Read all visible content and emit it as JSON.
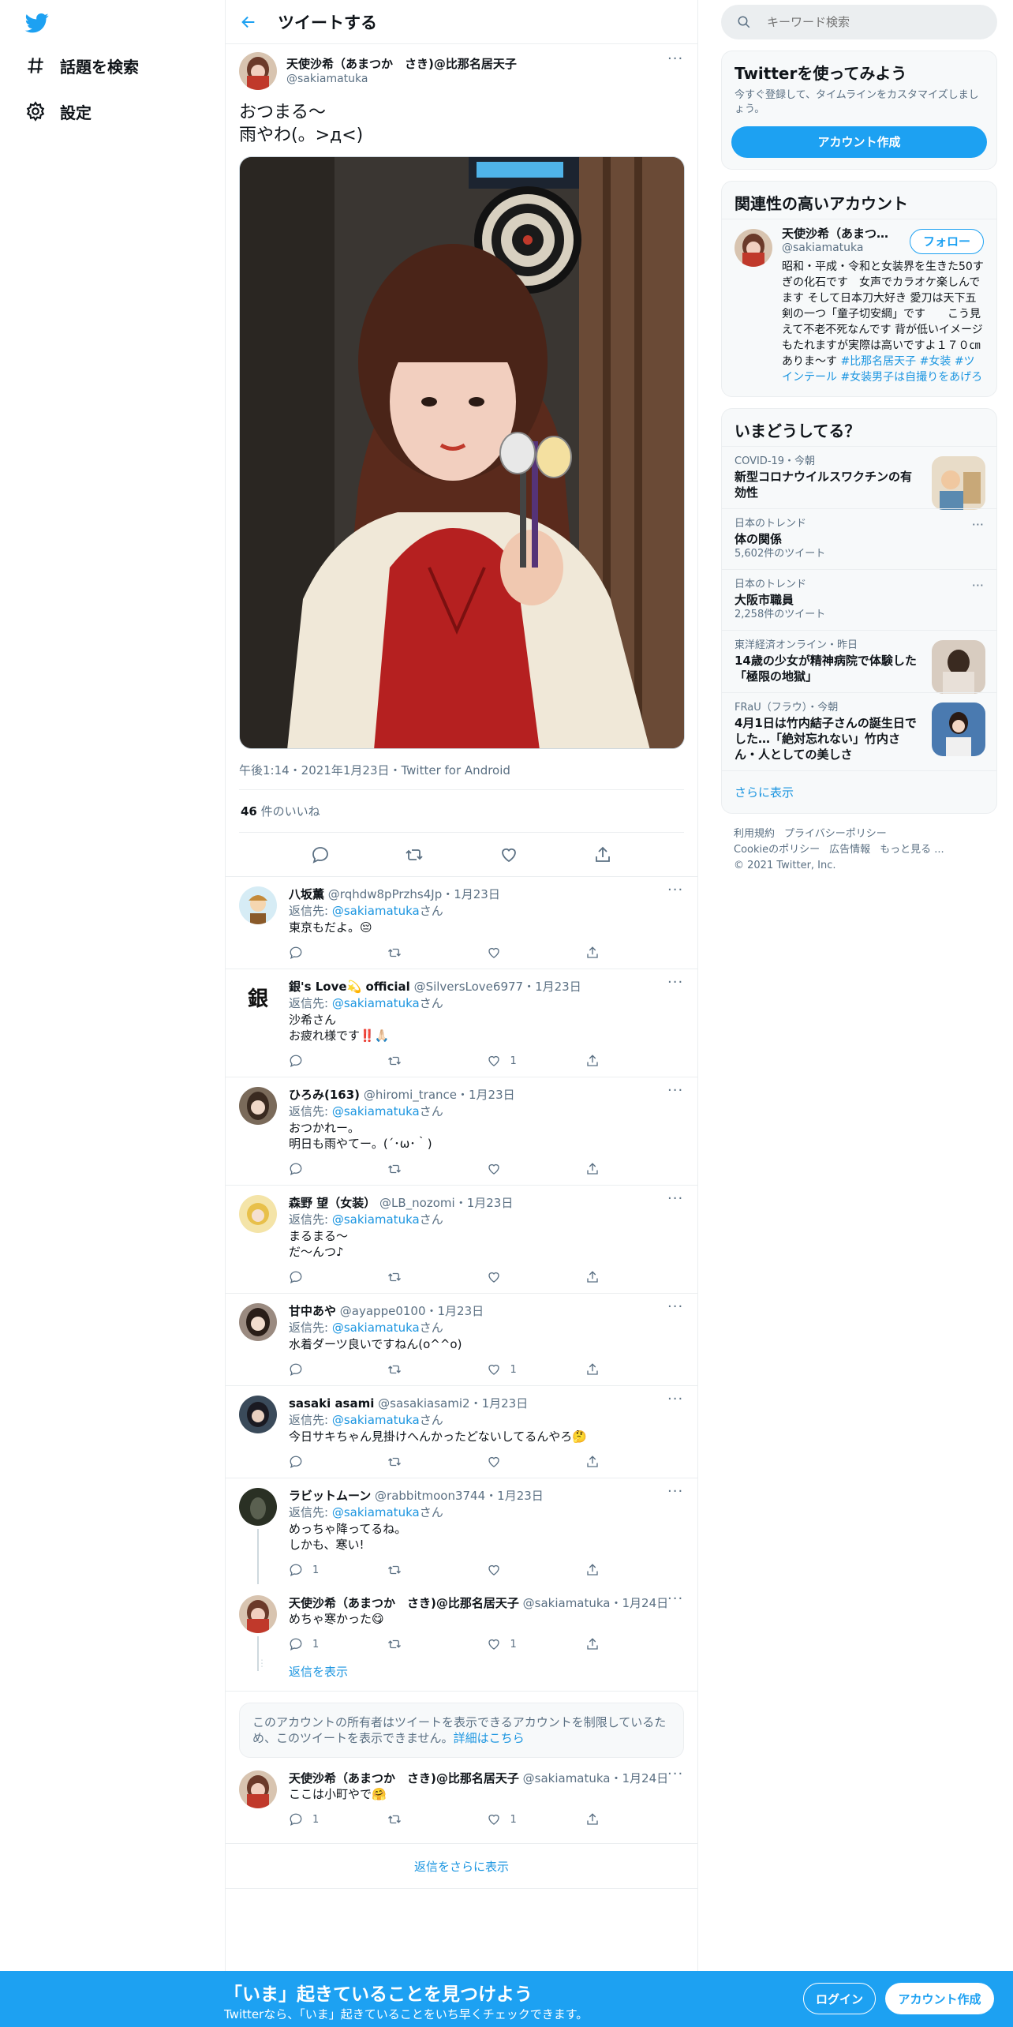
{
  "colors": {
    "brand": "#1da1f2",
    "link": "#1b95e0",
    "text": "#0f1419",
    "muted": "#5b7083"
  },
  "nav": {
    "logo_icon": "twitter-bird-icon",
    "items": [
      {
        "label": "話題を検索",
        "icon": "hashtag-icon"
      },
      {
        "label": "設定",
        "icon": "gear-icon"
      }
    ]
  },
  "header": {
    "title": "ツイートする"
  },
  "main_tweet": {
    "name": "天使沙希（あまつか　さき)@比那名居天子",
    "handle": "@sakiamatuka",
    "text": "おつまる〜\n雨やわ(。>д<)",
    "timestamp": "午後1:14・2021年1月23日・Twitter for Android",
    "likes_count": "46",
    "likes_label": " 件のいいね"
  },
  "replies": [
    {
      "name": "八坂薫",
      "handle": "@rqhdw8pPrzhs4Jp",
      "date": "・1月23日",
      "reply_to_label": "返信先: ",
      "reply_to": "@sakiamatuka",
      "reply_to_suffix": "さん",
      "text": "東京もだよ。😔",
      "reply_count": "",
      "retweet_count": "",
      "like_count": ""
    },
    {
      "name": "銀's Love💫 official",
      "handle": "@SilversLove6977",
      "date": "・1月23日",
      "reply_to_label": "返信先: ",
      "reply_to": "@sakiamatuka",
      "reply_to_suffix": "さん",
      "text": "沙希さん\nお疲れ様です‼️🙏🏻",
      "reply_count": "",
      "retweet_count": "",
      "like_count": "1"
    },
    {
      "name": "ひろみ(163)",
      "handle": "@hiromi_trance",
      "date": "・1月23日",
      "reply_to_label": "返信先: ",
      "reply_to": "@sakiamatuka",
      "reply_to_suffix": "さん",
      "text": "おつかれー。\n明日も雨やてー。(´･ω･｀)",
      "reply_count": "",
      "retweet_count": "",
      "like_count": ""
    },
    {
      "name": "森野 望（女装）",
      "handle": "@LB_nozomi",
      "date": "・1月23日",
      "reply_to_label": "返信先: ",
      "reply_to": "@sakiamatuka",
      "reply_to_suffix": "さん",
      "text": "まるまる〜\nだ〜んつ♪",
      "reply_count": "",
      "retweet_count": "",
      "like_count": ""
    },
    {
      "name": "甘中あや",
      "handle": "@ayappe0100",
      "date": "・1月23日",
      "reply_to_label": "返信先: ",
      "reply_to": "@sakiamatuka",
      "reply_to_suffix": "さん",
      "text": "水着ダーツ良いですねん(o^^o)",
      "reply_count": "",
      "retweet_count": "",
      "like_count": "1"
    },
    {
      "name": "sasaki asami",
      "handle": "@sasakiasami2",
      "date": "・1月23日",
      "reply_to_label": "返信先: ",
      "reply_to": "@sakiamatuka",
      "reply_to_suffix": "さん",
      "text": "今日サキちゃん見掛けへんかったどないしてるんやろ🤔",
      "reply_count": "",
      "retweet_count": "",
      "like_count": ""
    },
    {
      "name": "ラビットムーン",
      "handle": "@rabbitmoon3744",
      "date": "・1月23日",
      "reply_to_label": "返信先: ",
      "reply_to": "@sakiamatuka",
      "reply_to_suffix": "さん",
      "text": "めっちゃ降ってるね。\nしかも、寒い!",
      "reply_count": "1",
      "retweet_count": "",
      "like_count": ""
    },
    {
      "name": "天使沙希（あまつか　さき)@比那名居天子",
      "handle": "@sakiamatuka",
      "date": "・1月24日",
      "text": "めちゃ寒かった😋",
      "reply_count": "1",
      "retweet_count": "",
      "like_count": "1"
    }
  ],
  "show_replies_label": "返信を表示",
  "restricted_notice": {
    "text": "このアカウントの所有者はツイートを表示できるアカウントを制限しているため、このツイートを表示できません。",
    "link": "詳細はこちら"
  },
  "last_reply": {
    "name": "天使沙希（あまつか　さき)@比那名居天子",
    "handle": "@sakiamatuka",
    "date": "・1月24日",
    "text": "ここは小町やで🤗",
    "reply_count": "1",
    "retweet_count": "",
    "like_count": "1"
  },
  "more_replies_label": "返信をさらに表示",
  "search": {
    "placeholder": "キーワード検索"
  },
  "join_card": {
    "title": "Twitterを使ってみよう",
    "subtitle": "今すぐ登録して、タイムラインをカスタマイズしましょう。",
    "button": "アカウント作成"
  },
  "related": {
    "title": "関連性の高いアカウント",
    "name": "天使沙希（あまつか　さき)@比那名居天子",
    "handle": "@sakiamatuka",
    "follow_label": "フォロー",
    "bio": "昭和・平成・令和と女装界を生きた50すぎの化石です　女声でカラオケ楽しんでます そして日本刀大好き 愛刀は天下五剣の一つ「童子切安綱」です　　こう見えて不老不死なんです 背が低いイメージもたれますが実際は高いですよ１７０㎝ありま～す",
    "bio_tags": "#比那名居天子 #女装 #ツインテール #女装男子は自撮りをあげろ"
  },
  "trends": {
    "title": "いまどうしてる？",
    "items": [
      {
        "context": "COVID-19・今朝",
        "title": "新型コロナウイルスワクチンの有効性",
        "count": ""
      },
      {
        "context": "日本のトレンド",
        "title": "体の関係",
        "count": "5,602件のツイート"
      },
      {
        "context": "日本のトレンド",
        "title": "大阪市職員",
        "count": "2,258件のツイート"
      },
      {
        "context": "東洋経済オンライン・昨日",
        "title": "14歳の少女が精神病院で体験した「極限の地獄」",
        "count": ""
      },
      {
        "context": "FRaU（フラウ）・今朝",
        "title": "4月1日は竹内結子さんの誕生日でした…「絶対忘れない」竹内さん・人としての美しさ",
        "count": ""
      }
    ],
    "show_more": "さらに表示"
  },
  "footer": {
    "links": [
      "利用規約",
      "プライバシーポリシー",
      "Cookieのポリシー",
      "広告情報",
      "もっと見る ..."
    ],
    "copyright": "© 2021 Twitter, Inc."
  },
  "bottom_bar": {
    "title": "「いま」起きていることを見つけよう",
    "subtitle": "Twitterなら、「いま」起きていることをいち早くチェックできます。",
    "login": "ログイン",
    "signup": "アカウント作成"
  }
}
